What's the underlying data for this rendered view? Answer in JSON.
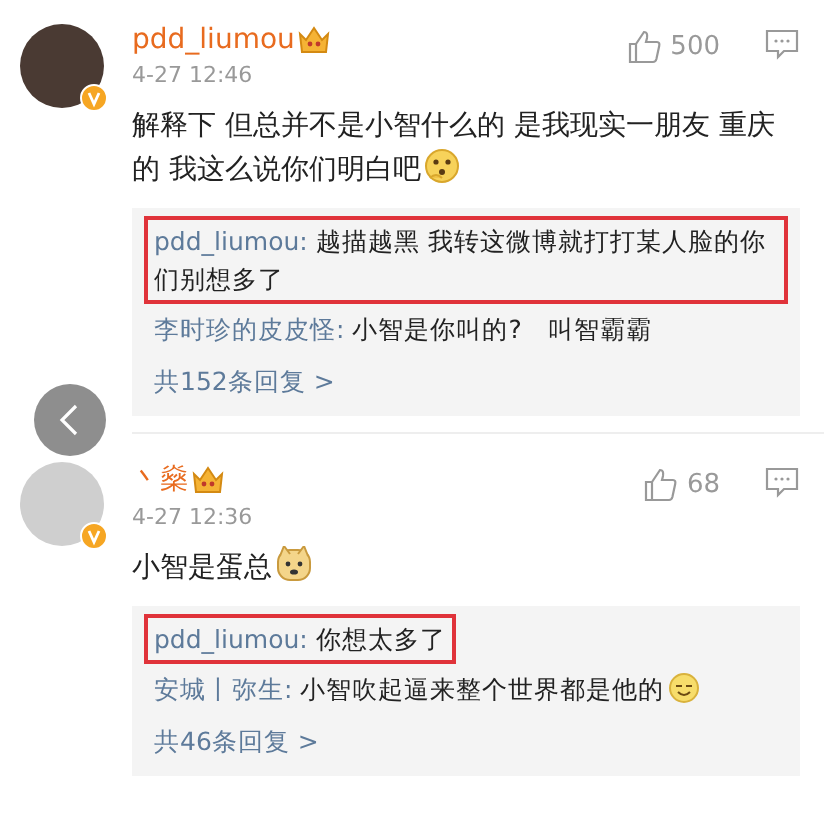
{
  "comments": [
    {
      "user": "pdd_liumou",
      "time": "4-27 12:46",
      "likes": "500",
      "text": "解释下 但总并不是小智什么的 是我现实一朋友 重庆的 我这么说你们明白吧",
      "emoji": {
        "kind": "thinking"
      },
      "replies": [
        {
          "user": "pdd_liumou:",
          "text": "越描越黑 我转这微博就打打某人脸的你们别想多了",
          "highlighted": true
        },
        {
          "user": "李时珍的皮皮怪:",
          "text": "小智是你叫的?　叫智霸霸",
          "highlighted": false
        }
      ],
      "more": "共152条回复 >"
    },
    {
      "user": "丶燊",
      "time": "4-27 12:36",
      "likes": "68",
      "text": "小智是蛋总",
      "emoji": {
        "kind": "doge"
      },
      "replies": [
        {
          "user": "pdd_liumou:",
          "text": "你想太多了",
          "highlighted": true
        },
        {
          "user": "安城丨弥生:",
          "text": "小智吹起逼来整个世界都是他的",
          "highlighted": false,
          "emoji": {
            "kind": "smile"
          }
        }
      ],
      "more": "共46条回复 >"
    }
  ]
}
